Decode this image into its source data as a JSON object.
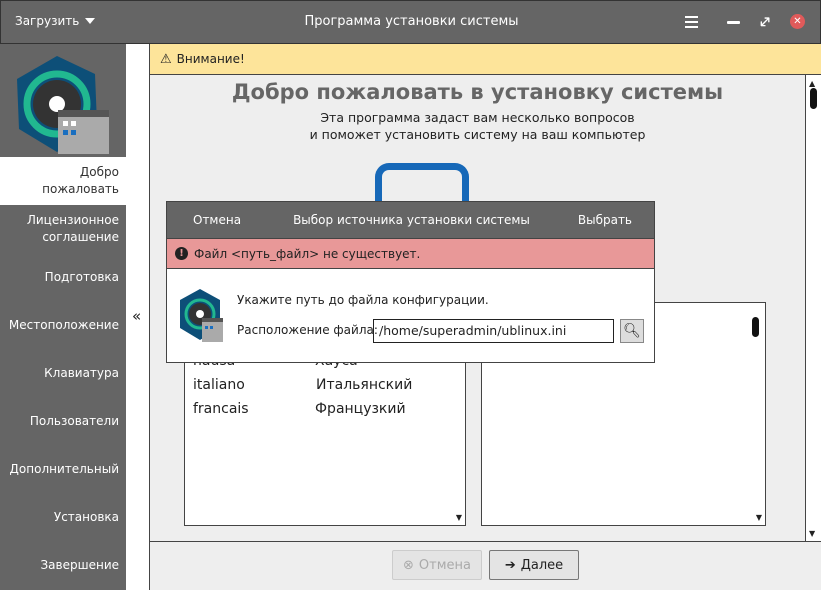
{
  "titlebar": {
    "load_menu": "Загрузить",
    "title": "Программа установки системы"
  },
  "warning": {
    "text": "Внимание!"
  },
  "sidebar": {
    "collapse": "«",
    "items": [
      {
        "label": "Добро пожаловать",
        "selected": true
      },
      {
        "label": "Лицензионное соглашение"
      },
      {
        "label": "Подготовка"
      },
      {
        "label": "Местоположение"
      },
      {
        "label": "Клавиатура"
      },
      {
        "label": "Пользователи"
      },
      {
        "label": "Дополнительный"
      },
      {
        "label": "Установка"
      },
      {
        "label": "Завершение"
      }
    ]
  },
  "main": {
    "heading": "Добро пожаловать в установку системы",
    "subtitle1": "Эта программа задаст вам несколько вопросов",
    "subtitle2": "и поможет установить систему на ваш компьютер",
    "languages": [
      {
        "code": "hausa",
        "name": "Хауса"
      },
      {
        "code": "italiano",
        "name": "Итальянский"
      },
      {
        "code": "francais",
        "name": "Французкий"
      }
    ]
  },
  "footer": {
    "cancel": "Отмена",
    "next": "Далее"
  },
  "dialog": {
    "cancel": "Отмена",
    "title": "Выбор источника установки системы",
    "select": "Выбрать",
    "error": "Файл <путь_файл> не существует.",
    "prompt": "Укажите путь до файла конфигурации.",
    "file_label": "Расположение файла:",
    "file_value": "/home/superadmin/ublinux.ini"
  },
  "colors": {
    "bar": "#656565",
    "warning": "#fde49a",
    "error": "#e89898",
    "close": "#e05a5a"
  }
}
